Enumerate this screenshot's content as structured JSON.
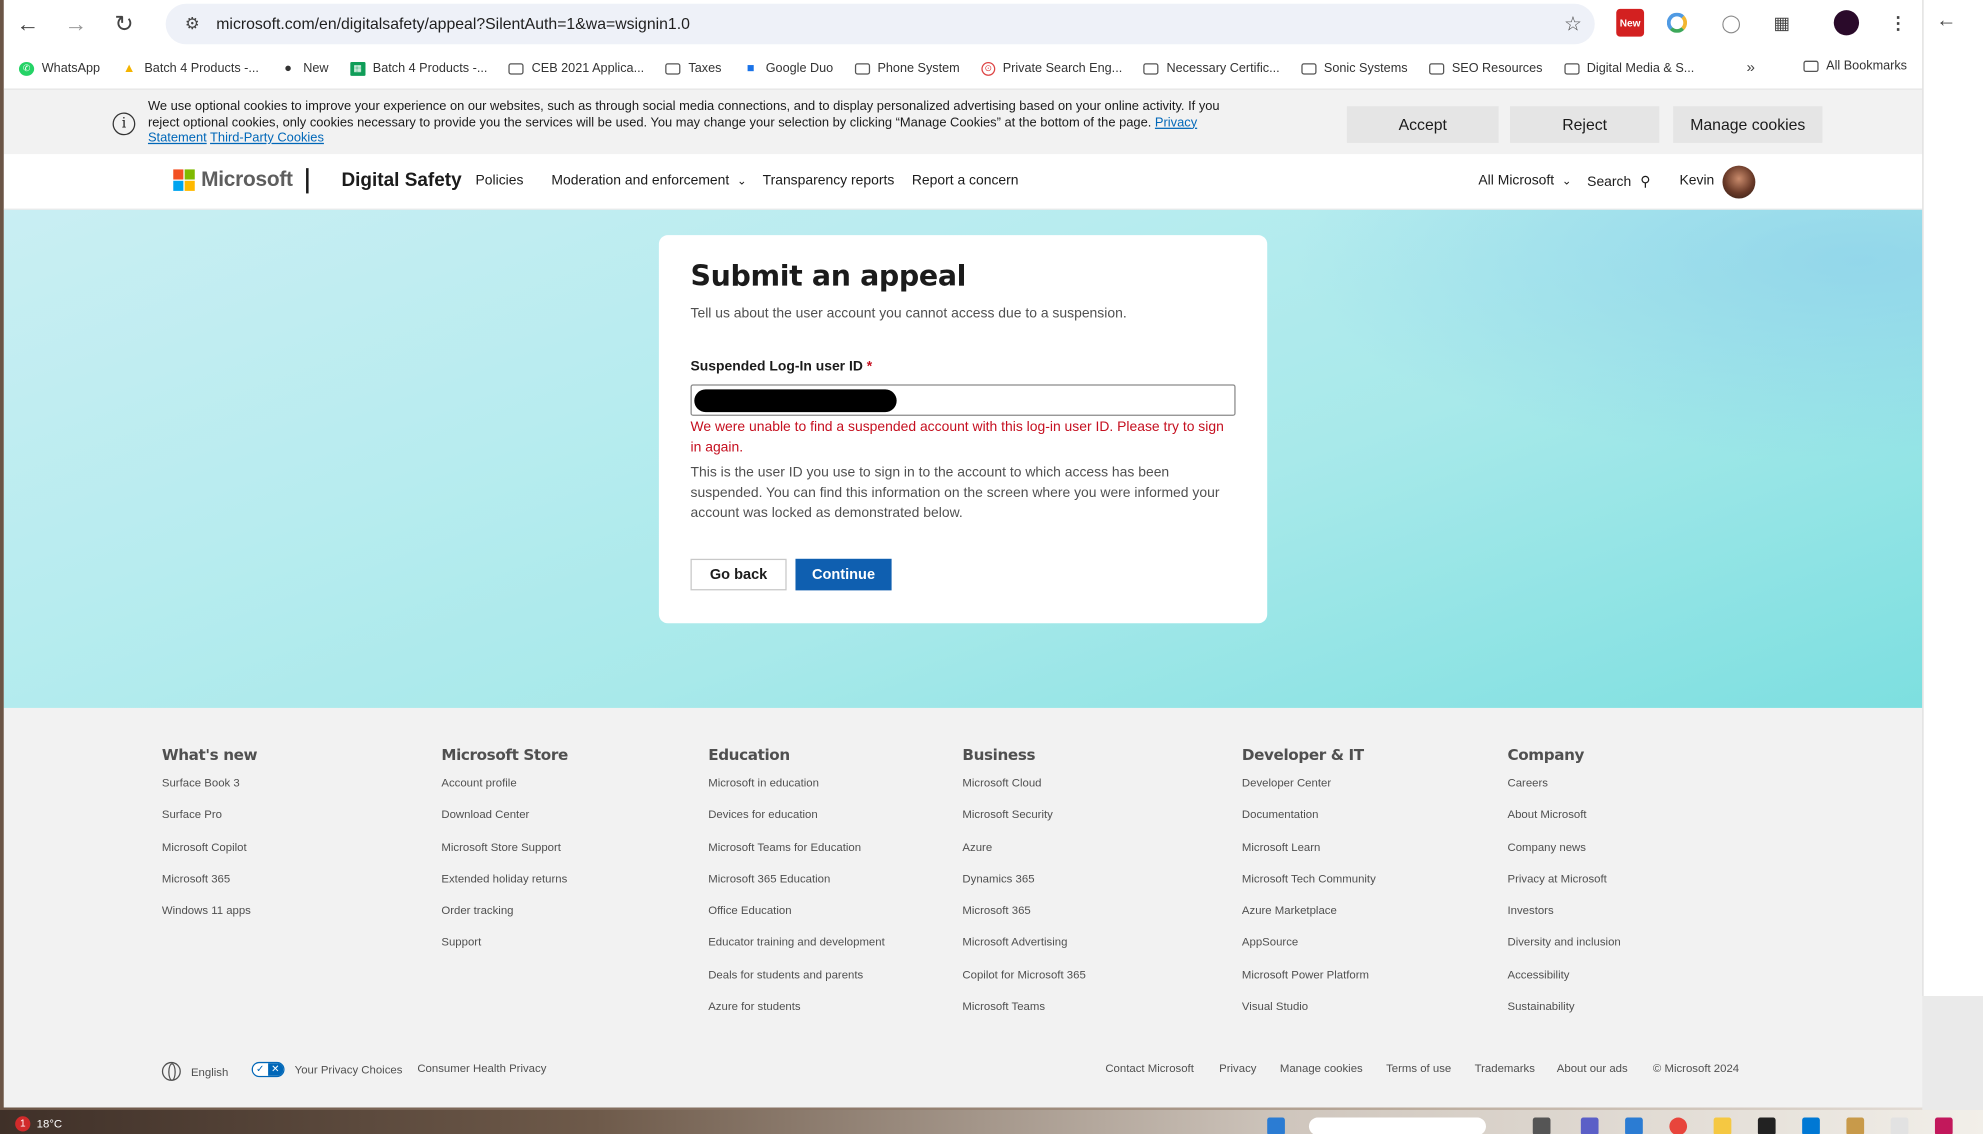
{
  "browser": {
    "url": "microsoft.com/en/digitalsafety/appeal?SilentAuth=1&wa=wsignin1.0",
    "ext_new_label": "New"
  },
  "bookmarks": {
    "items": [
      {
        "label": "WhatsApp",
        "icon": "whatsapp-icon"
      },
      {
        "label": "Batch 4 Products -...",
        "icon": "google-drive-icon"
      },
      {
        "label": "New",
        "icon": "github-icon"
      },
      {
        "label": "Batch 4 Products -...",
        "icon": "google-sheets-icon"
      },
      {
        "label": "CEB 2021 Applica...",
        "icon": "folder-icon"
      },
      {
        "label": "Taxes",
        "icon": "folder-icon"
      },
      {
        "label": "Google Duo",
        "icon": "google-duo-icon"
      },
      {
        "label": "Phone System",
        "icon": "folder-icon"
      },
      {
        "label": "Private Search Eng...",
        "icon": "private-search-icon"
      },
      {
        "label": "Necessary Certific...",
        "icon": "folder-icon"
      },
      {
        "label": "Sonic Systems",
        "icon": "folder-icon"
      },
      {
        "label": "SEO Resources",
        "icon": "folder-icon"
      },
      {
        "label": "Digital Media & S...",
        "icon": "folder-icon"
      }
    ],
    "more": "»",
    "all_bookmarks": "All Bookmarks"
  },
  "cookie": {
    "text": "We use optional cookies to improve your experience on our websites, such as through social media connections, and to display personalized advertising based on your online activity. If you reject optional cookies, only cookies necessary to provide you the services will be used. You may change your selection by clicking “Manage Cookies” at the bottom of the page.",
    "privacy_link": "Privacy Statement",
    "third_party_link": "Third-Party Cookies",
    "accept": "Accept",
    "reject": "Reject",
    "manage": "Manage cookies",
    "info_glyph": "i"
  },
  "header": {
    "brand": "Microsoft",
    "site_title": "Digital Safety",
    "nav": [
      "Policies",
      "Moderation and enforcement",
      "Transparency reports",
      "Report a concern"
    ],
    "all_microsoft": "All Microsoft",
    "search": "Search",
    "user": "Kevin",
    "logo_colors": [
      "#f25022",
      "#7fba00",
      "#00a4ef",
      "#ffb900"
    ]
  },
  "form": {
    "title": "Submit an appeal",
    "subtitle": "Tell us about the user account you cannot access due to a suspension.",
    "field_label": "Suspended Log-In user ID",
    "required_mark": "*",
    "error": "We were unable to find a suspended account with this log-in user ID. Please try to sign in again.",
    "help": "This is the user ID you use to sign in to the account to which access has been suspended. You can find this information on the screen where you were informed your account was locked as demonstrated below.",
    "back_button": "Go back",
    "continue_button": "Continue",
    "error_color": "#c50f1f",
    "primary_color": "#0f5fb0"
  },
  "footer": {
    "columns": [
      {
        "title": "What's new",
        "links": [
          "Surface Book 3",
          "Surface Pro",
          "Microsoft Copilot",
          "Microsoft 365",
          "Windows 11 apps"
        ]
      },
      {
        "title": "Microsoft Store",
        "links": [
          "Account profile",
          "Download Center",
          "Microsoft Store Support",
          "Extended holiday returns",
          "Order tracking",
          "Support"
        ]
      },
      {
        "title": "Education",
        "links": [
          "Microsoft in education",
          "Devices for education",
          "Microsoft Teams for Education",
          "Microsoft 365 Education",
          "Office Education",
          "Educator training and development",
          "Deals for students and parents",
          "Azure for students"
        ]
      },
      {
        "title": "Business",
        "links": [
          "Microsoft Cloud",
          "Microsoft Security",
          "Azure",
          "Dynamics 365",
          "Microsoft 365",
          "Microsoft Advertising",
          "Copilot for Microsoft 365",
          "Microsoft Teams"
        ]
      },
      {
        "title": "Developer & IT",
        "links": [
          "Developer Center",
          "Documentation",
          "Microsoft Learn",
          "Microsoft Tech Community",
          "Azure Marketplace",
          "AppSource",
          "Microsoft Power Platform",
          "Visual Studio"
        ]
      },
      {
        "title": "Company",
        "links": [
          "Careers",
          "About Microsoft",
          "Company news",
          "Privacy at Microsoft",
          "Investors",
          "Diversity and inclusion",
          "Accessibility",
          "Sustainability"
        ]
      }
    ],
    "language": "English",
    "privacy_choices": "Your Privacy Choices",
    "consumer_health": "Consumer Health Privacy",
    "links_right": [
      "Contact Microsoft",
      "Privacy",
      "Manage cookies",
      "Terms of use",
      "Trademarks",
      "About our ads",
      "© Microsoft 2024"
    ]
  },
  "taskbar": {
    "weather": "18°C",
    "weather_badge": "1"
  }
}
